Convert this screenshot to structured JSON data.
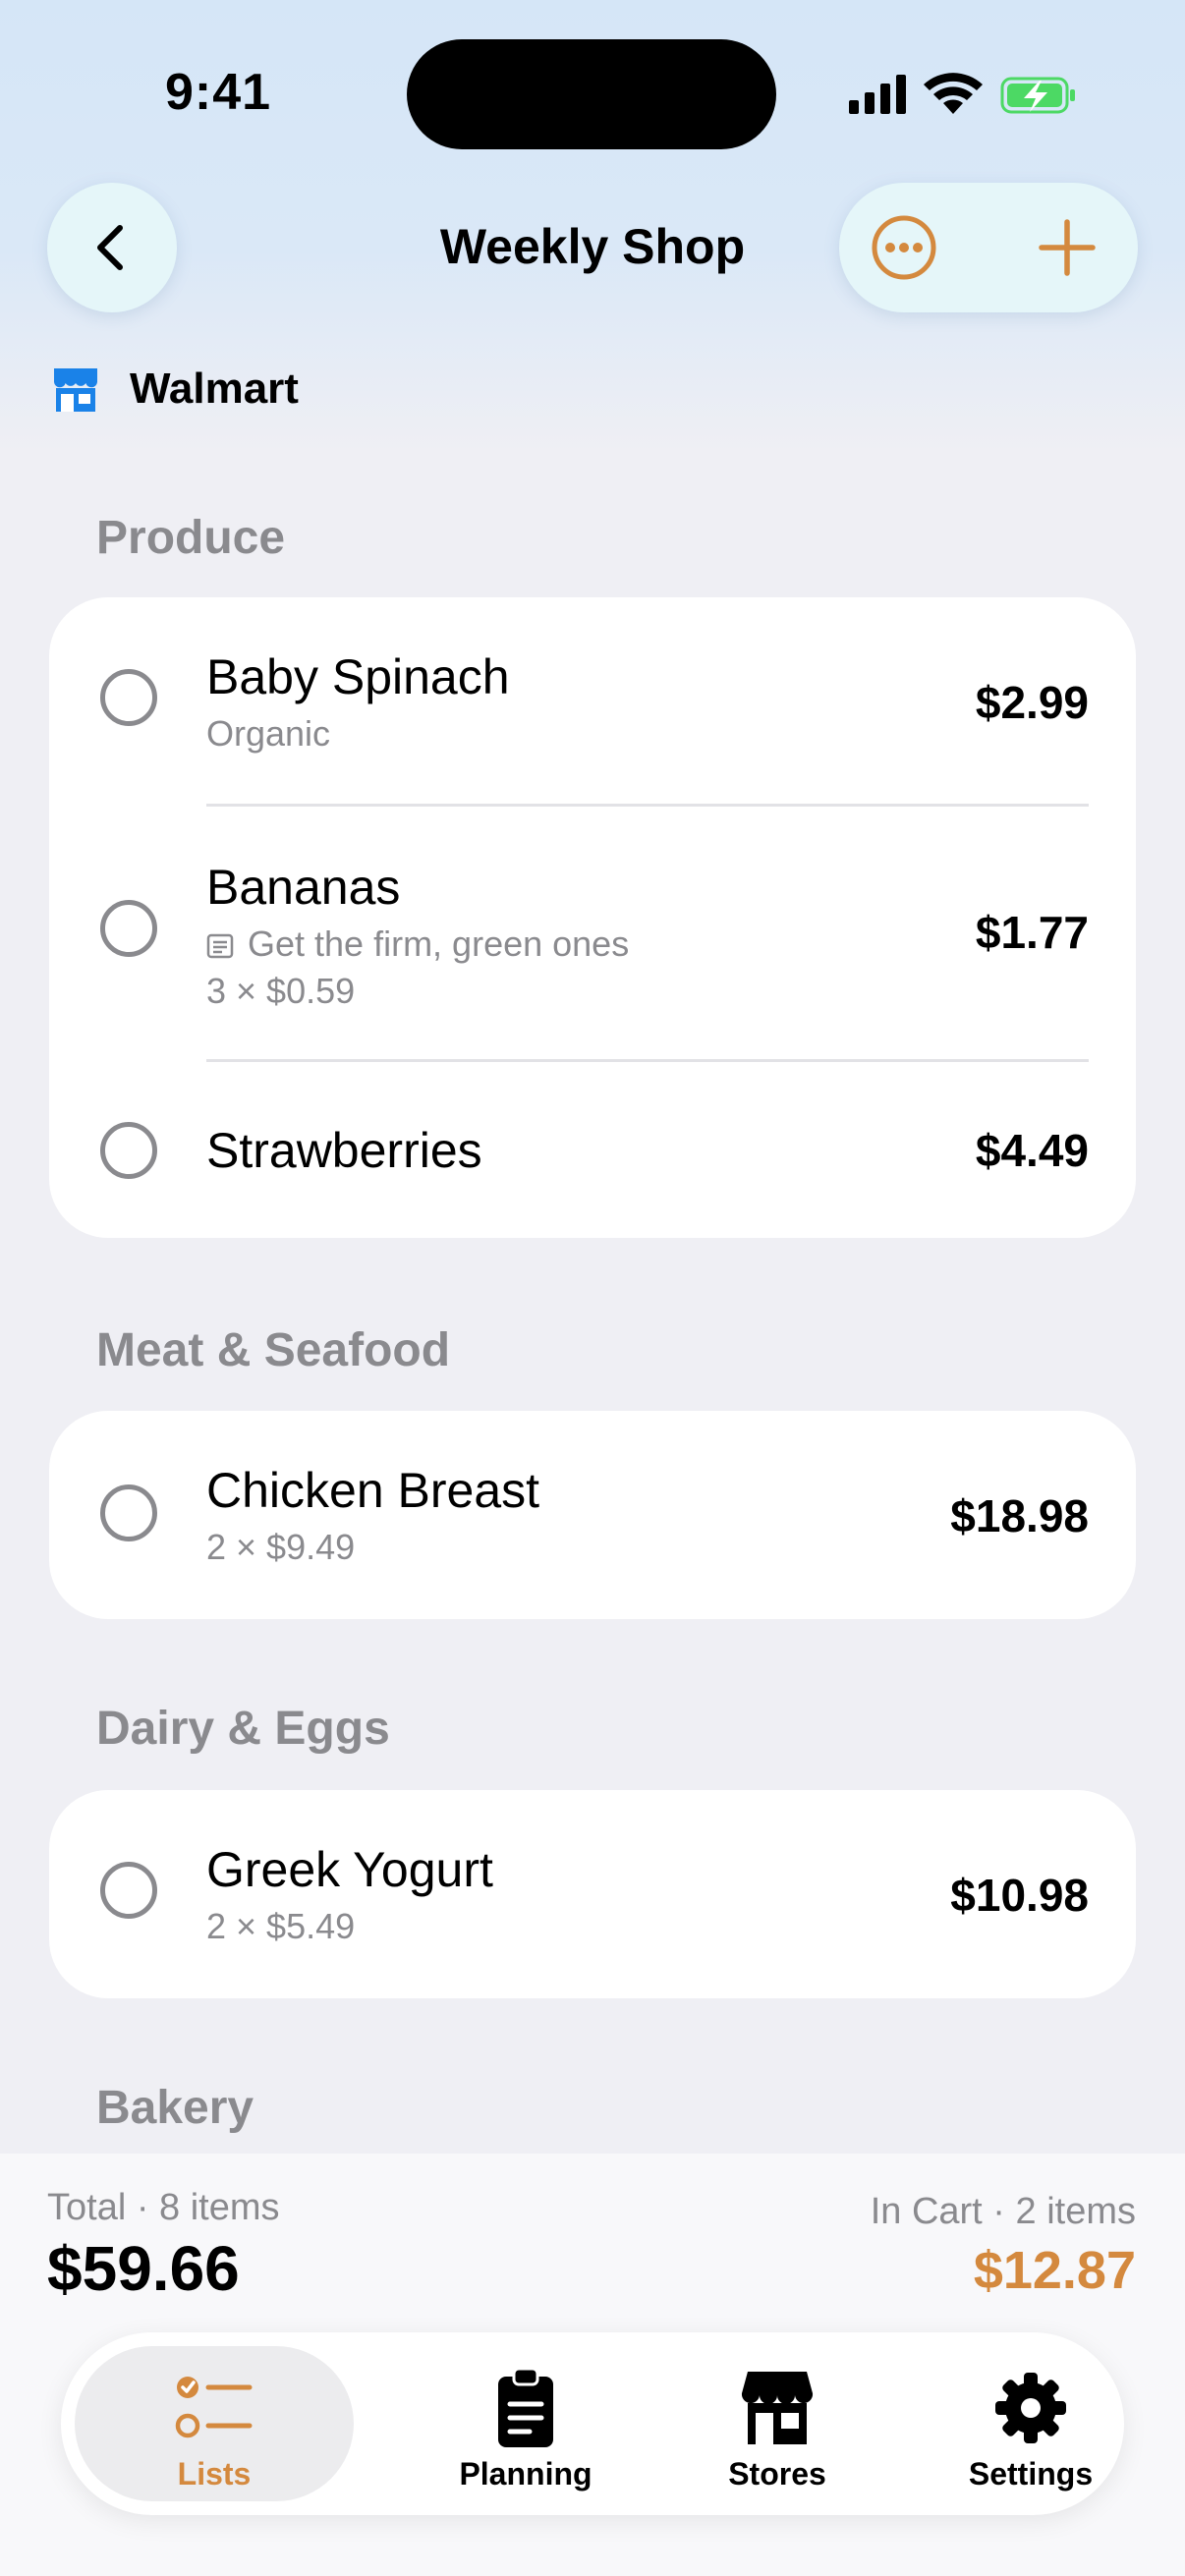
{
  "status_bar": {
    "time": "9:41"
  },
  "header": {
    "title": "Weekly Shop",
    "store": "Walmart"
  },
  "sections": [
    {
      "title": "Produce",
      "items": [
        {
          "name": "Baby Spinach",
          "subtitle": "Organic",
          "price": "$2.99"
        },
        {
          "name": "Bananas",
          "note": "Get the firm, green ones",
          "quantity": "3 × $0.59",
          "price": "$1.77"
        },
        {
          "name": "Strawberries",
          "price": "$4.49"
        }
      ]
    },
    {
      "title": "Meat & Seafood",
      "items": [
        {
          "name": "Chicken Breast",
          "quantity": "2 × $9.49",
          "price": "$18.98"
        }
      ]
    },
    {
      "title": "Dairy & Eggs",
      "items": [
        {
          "name": "Greek Yogurt",
          "quantity": "2 × $5.49",
          "price": "$10.98"
        }
      ]
    },
    {
      "title": "Bakery"
    }
  ],
  "footer": {
    "total_label": "Total · 8 items",
    "total_value": "$59.66",
    "cart_label": "In Cart · 2 items",
    "cart_value": "$12.87"
  },
  "tabs": [
    {
      "label": "Lists",
      "icon": "checklist-icon",
      "active": true
    },
    {
      "label": "Planning",
      "icon": "clipboard-icon"
    },
    {
      "label": "Stores",
      "icon": "storefront-icon"
    },
    {
      "label": "Settings",
      "icon": "gear-icon"
    }
  ],
  "colors": {
    "accent": "#d4893e",
    "store_icon": "#1a82e8",
    "background": "#efeff4",
    "muted": "#8a8a8e"
  }
}
